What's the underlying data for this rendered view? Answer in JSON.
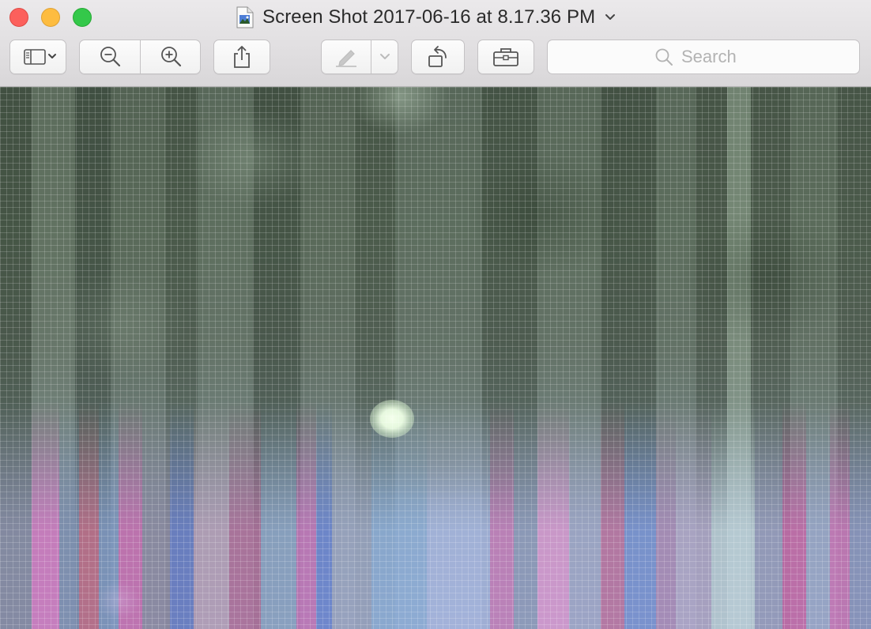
{
  "window": {
    "title": "Screen Shot 2017-06-16 at 8.17.36 PM",
    "title_chevron_icon": "chevron-down-icon",
    "document_icon": "image-document-icon",
    "traffic_lights": [
      {
        "name": "close",
        "color": "#fc605c"
      },
      {
        "name": "minimize",
        "color": "#fdbc40"
      },
      {
        "name": "zoom",
        "color": "#34c84a"
      }
    ]
  },
  "toolbar": {
    "buttons": [
      {
        "name": "sidebar-view-menu",
        "icon": "sidebar-icon",
        "has_chevron": true
      },
      {
        "name": "zoom-out",
        "icon": "zoom-out-icon"
      },
      {
        "name": "zoom-in",
        "icon": "zoom-in-icon"
      },
      {
        "name": "share",
        "icon": "share-icon"
      },
      {
        "name": "markup",
        "icon": "markup-pen-icon",
        "has_chevron": true,
        "enabled": false
      },
      {
        "name": "rotate",
        "icon": "rotate-left-icon"
      },
      {
        "name": "markup-toolbar",
        "icon": "toolbox-icon"
      }
    ],
    "search": {
      "placeholder": "Search",
      "value": "",
      "icon": "search-icon"
    }
  },
  "canvas": {
    "content": "image",
    "grid_overlay": true
  }
}
